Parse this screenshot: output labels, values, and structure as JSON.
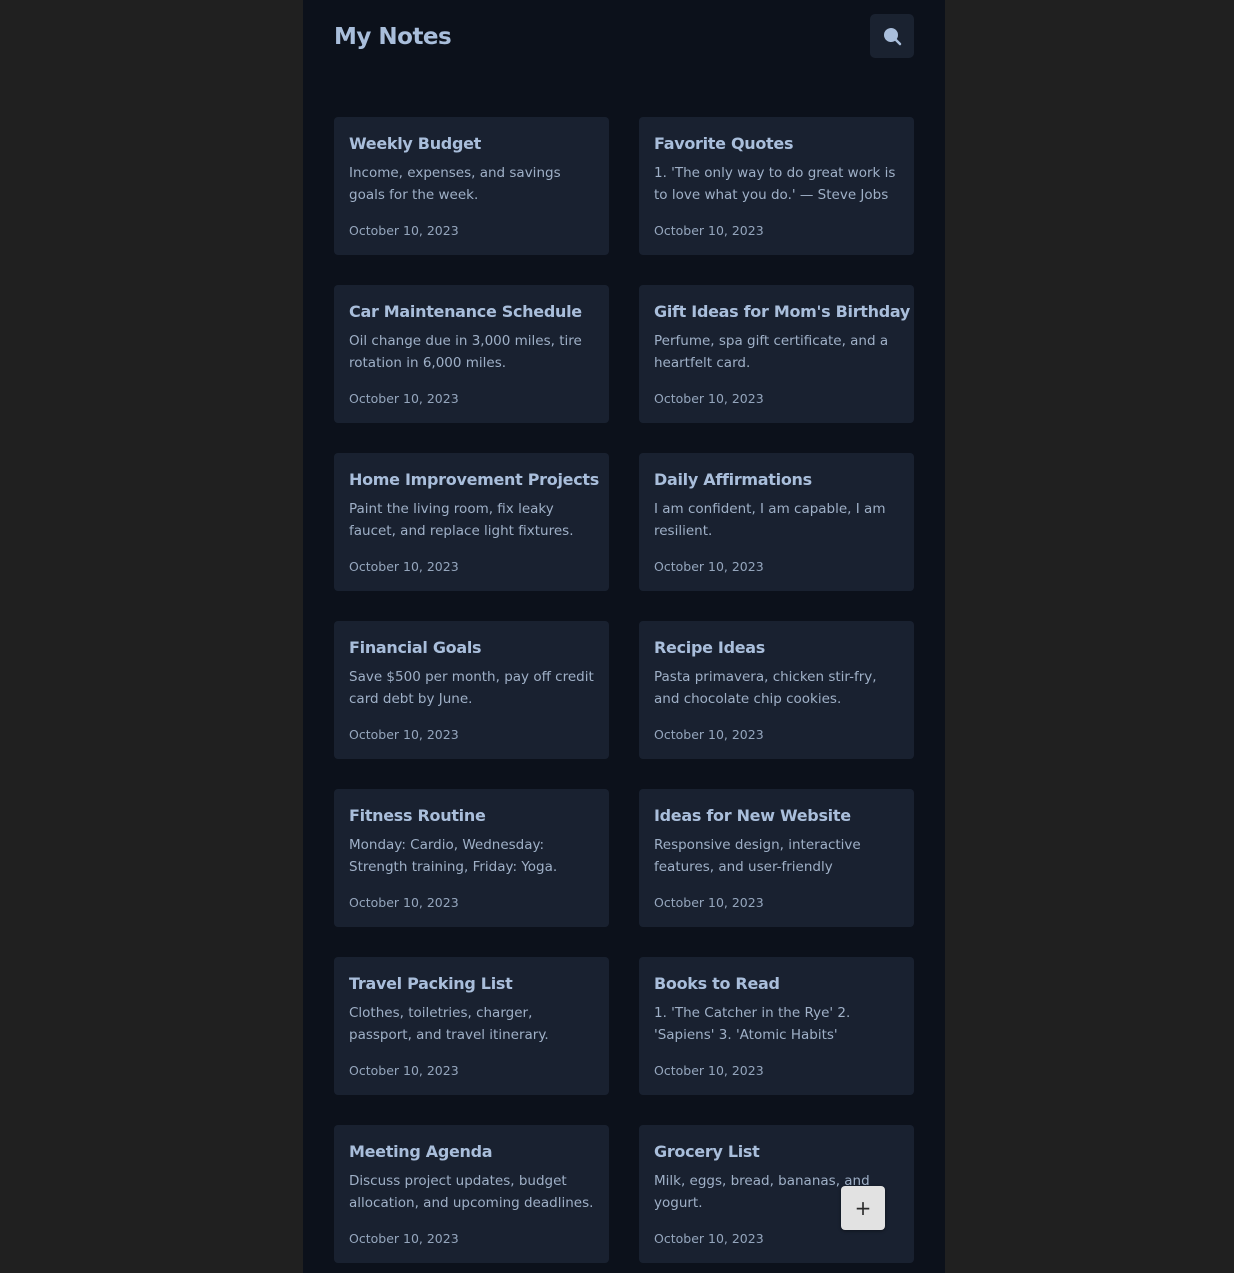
{
  "header": {
    "title": "My Notes",
    "search_icon": "search-icon"
  },
  "notes": [
    {
      "title": "Weekly Budget",
      "body": "Income, expenses, and savings goals for the week.",
      "date": "October 10, 2023"
    },
    {
      "title": "Favorite Quotes",
      "body": "1. 'The only way to do great work is to love what you do.' — Steve Jobs",
      "date": "October 10, 2023"
    },
    {
      "title": "Car Maintenance Schedule",
      "body": "Oil change due in 3,000 miles, tire rotation in 6,000 miles.",
      "date": "October 10, 2023"
    },
    {
      "title": "Gift Ideas for Mom's Birthday",
      "body": "Perfume, spa gift certificate, and a heartfelt card.",
      "date": "October 10, 2023"
    },
    {
      "title": "Home Improvement Projects",
      "body": "Paint the living room, fix leaky faucet, and replace light fixtures.",
      "date": "October 10, 2023"
    },
    {
      "title": "Daily Affirmations",
      "body": "I am confident, I am capable, I am resilient.",
      "date": "October 10, 2023"
    },
    {
      "title": "Financial Goals",
      "body": "Save $500 per month, pay off credit card debt by June.",
      "date": "October 10, 2023"
    },
    {
      "title": "Recipe Ideas",
      "body": "Pasta primavera, chicken stir-fry, and chocolate chip cookies.",
      "date": "October 10, 2023"
    },
    {
      "title": "Fitness Routine",
      "body": "Monday: Cardio, Wednesday: Strength training, Friday: Yoga.",
      "date": "October 10, 2023"
    },
    {
      "title": "Ideas for New Website",
      "body": "Responsive design, interactive features, and user-friendly interface.",
      "date": "October 10, 2023"
    },
    {
      "title": "Travel Packing List",
      "body": "Clothes, toiletries, charger, passport, and travel itinerary.",
      "date": "October 10, 2023"
    },
    {
      "title": "Books to Read",
      "body": "1. 'The Catcher in the Rye' 2. 'Sapiens' 3. 'Atomic Habits'",
      "date": "October 10, 2023"
    },
    {
      "title": "Meeting Agenda",
      "body": "Discuss project updates, budget allocation, and upcoming deadlines.",
      "date": "October 10, 2023"
    },
    {
      "title": "Grocery List",
      "body": "Milk, eggs, bread, bananas, and yogurt.",
      "date": "October 10, 2023"
    }
  ],
  "fab": {
    "label": "+",
    "icon": "plus-icon"
  },
  "colors": {
    "page_bg": "#202020",
    "app_bg": "#0c111b",
    "card_bg": "#192130",
    "title_text": "#a9bedb",
    "body_text": "#9fb0c7",
    "fab_bg": "#e2e2e2"
  }
}
